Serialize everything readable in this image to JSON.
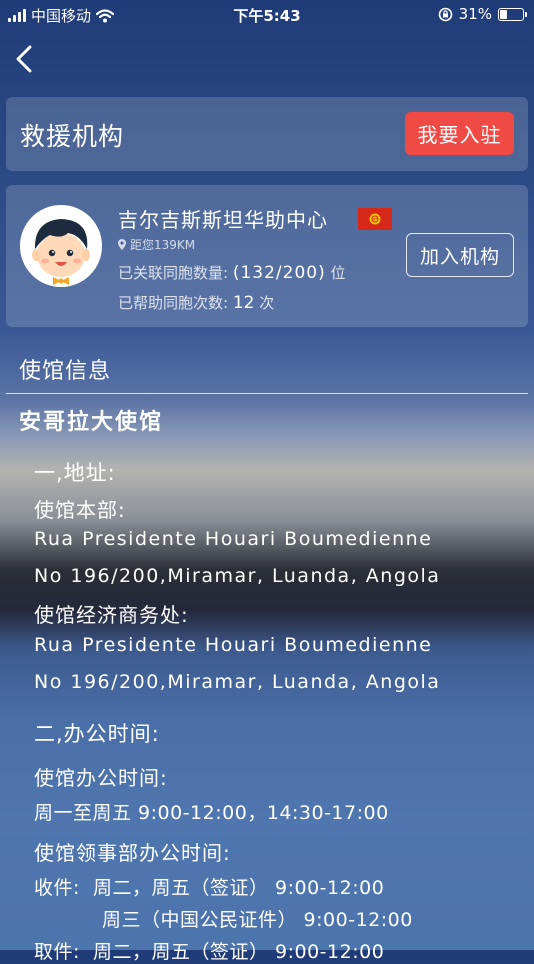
{
  "status_bar": {
    "carrier": "中国移动",
    "time": "下午5:43",
    "battery_percent": "31%",
    "battery_level": 0.31
  },
  "header": {
    "title": "救援机构",
    "join_button": "我要入驻"
  },
  "organization": {
    "name": "吉尔吉斯斯坦华助中心",
    "distance": "距您139KM",
    "linked_label": "已关联同胞数量:",
    "linked_count": "(132/200)",
    "linked_unit": "位",
    "helped_label": "已帮助同胞次数:",
    "helped_count": "12",
    "helped_unit": "次",
    "join_button": "加入机构",
    "flag_color": "#d62718",
    "flag_emblem_color": "#f4c400"
  },
  "embassy_section": {
    "title": "使馆信息",
    "embassy_name": "安哥拉大使馆",
    "lines": [
      "一,地址:",
      "使馆本部:",
      "Rua Presidente Houari Boumedienne",
      "No 196/200,Miramar, Luanda, Angola",
      "使馆经济商务处:",
      "Rua Presidente Houari Boumedienne",
      "No 196/200,Miramar, Luanda, Angola",
      "二,办公时间:",
      "使馆办公时间:",
      "周一至周五 9:00-12:00，14:30-17:00",
      "使馆领事部办公时间:",
      "收件:  周二，周五（签证） 9:00-12:00",
      "周三（中国公民证件） 9:00-12:00",
      "取件:  周二，周五（签证） 9:00-12:00"
    ]
  },
  "colors": {
    "accent_red": "#f04a45",
    "panel_overlay": "rgba(255,255,255,0.17)"
  }
}
